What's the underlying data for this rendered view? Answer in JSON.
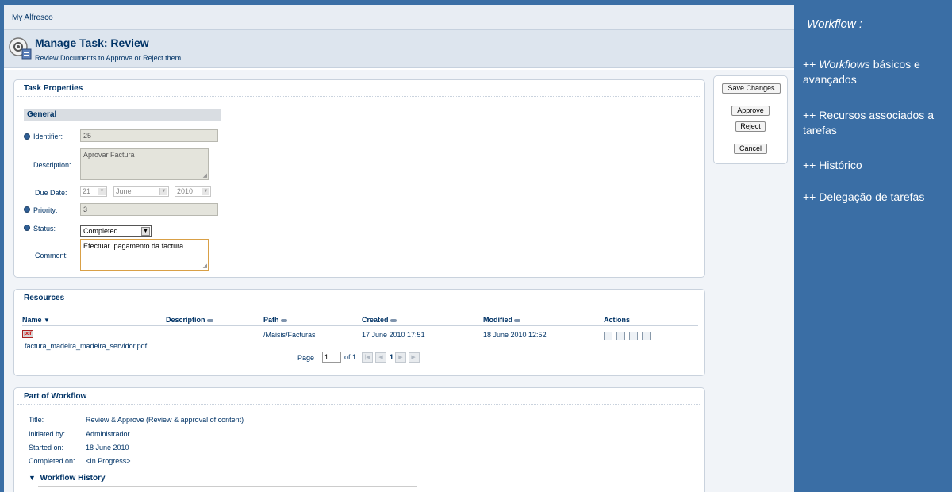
{
  "breadcrumb": "My Alfresco",
  "header": {
    "title": "Manage Task: Review",
    "subtitle": "Review Documents to Approve or Reject them"
  },
  "task_properties": {
    "title": "Task Properties",
    "section": "General",
    "identifier_label": "Identifier:",
    "identifier_value": "25",
    "description_label": "Description:",
    "description_value": "Aprovar Factura",
    "due_date_label": "Due Date:",
    "due_day": "21",
    "due_month": "June",
    "due_year": "2010",
    "priority_label": "Priority:",
    "priority_value": "3",
    "status_label": "Status:",
    "status_value": "Completed",
    "comment_label": "Comment:",
    "comment_value": "Efectuar  pagamento da factura"
  },
  "resources": {
    "title": "Resources",
    "columns": [
      "Name",
      "Description",
      "Path",
      "Created",
      "Modified",
      "Actions"
    ],
    "row": {
      "icon_label": "pdf",
      "name": "factura_madeira_madeira_servidor.pdf",
      "path": "/Maisis/Facturas",
      "created": "17 June 2010 17:51",
      "modified": "18 June 2010 12:52"
    },
    "pager": {
      "page_label": "Page",
      "page_value": "1",
      "of_label": "of 1",
      "current": "1"
    }
  },
  "workflow": {
    "title": "Part of Workflow",
    "title_label": "Title:",
    "title_value": "Review & Approve (Review & approval of content)",
    "initiated_label": "Initiated by:",
    "initiated_value": "Administrador .",
    "started_label": "Started on:",
    "started_value": "18 June 2010",
    "completed_label": "Completed on:",
    "completed_value": "<In Progress>",
    "history_label": "Workflow History"
  },
  "actions": {
    "save": "Save Changes",
    "approve": "Approve",
    "reject": "Reject",
    "cancel": "Cancel"
  },
  "slide": {
    "heading": "Workflow :",
    "note1_prefix": "++ ",
    "note1_em": "Workflows",
    "note1_rest": " básicos e avançados",
    "note2": "++ Recursos associados a tarefas",
    "note3": "++ Histórico",
    "note4": "++ Delegação de tarefas"
  }
}
